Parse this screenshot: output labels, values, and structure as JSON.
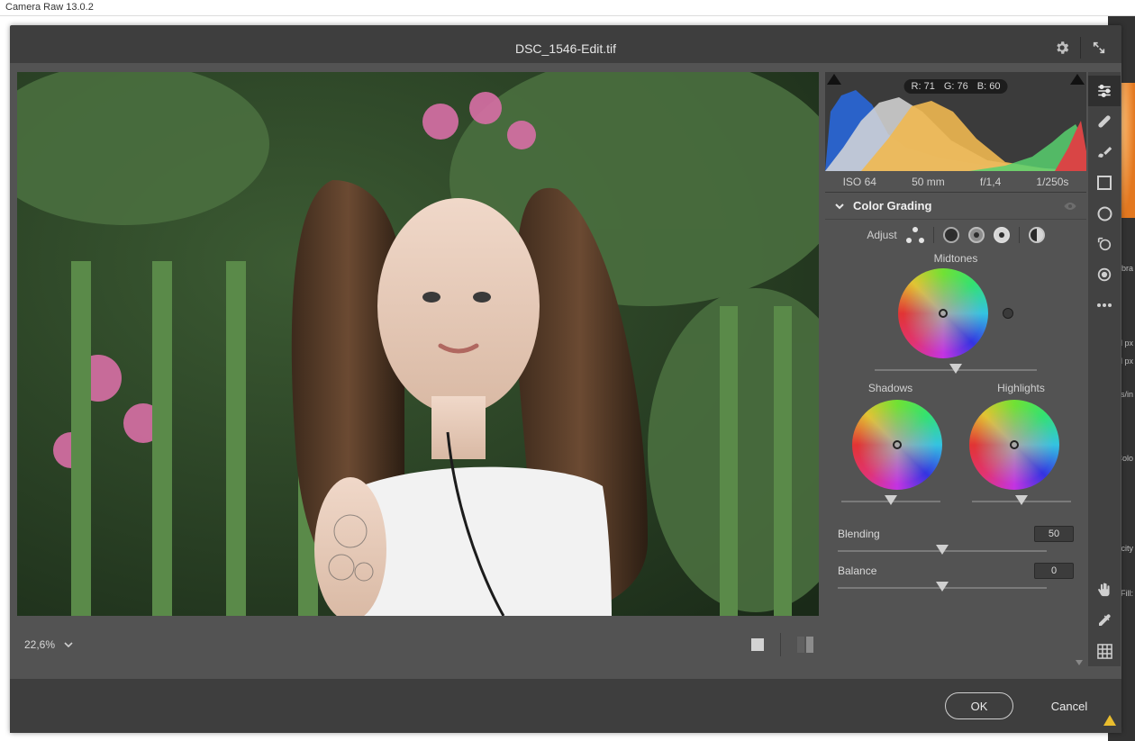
{
  "os_title": "Camera Raw 13.0.2",
  "header": {
    "filename": "DSC_1546-Edit.tif"
  },
  "rgb": {
    "r_label": "R:",
    "r": "71",
    "g_label": "G:",
    "g": "76",
    "b_label": "B:",
    "b": "60"
  },
  "exif": {
    "iso": "ISO 64",
    "focal": "50 mm",
    "aperture": "f/1,4",
    "shutter": "1/250s"
  },
  "section": {
    "title": "Color Grading",
    "adjust_label": "Adjust"
  },
  "wheels": {
    "midtones": "Midtones",
    "shadows": "Shadows",
    "highlights": "Highlights"
  },
  "controls": {
    "blending_label": "Blending",
    "blending_value": "50",
    "balance_label": "Balance",
    "balance_value": "0"
  },
  "zoom": {
    "value": "22,6%"
  },
  "footer": {
    "ok": "OK",
    "cancel": "Cancel"
  },
  "ps_background": {
    "lib": "Libra",
    "px1": "l px",
    "px2": "l px",
    "ppi": "els/in",
    "col": "Colo",
    "opa": "acity",
    "fill": "Fill:"
  }
}
